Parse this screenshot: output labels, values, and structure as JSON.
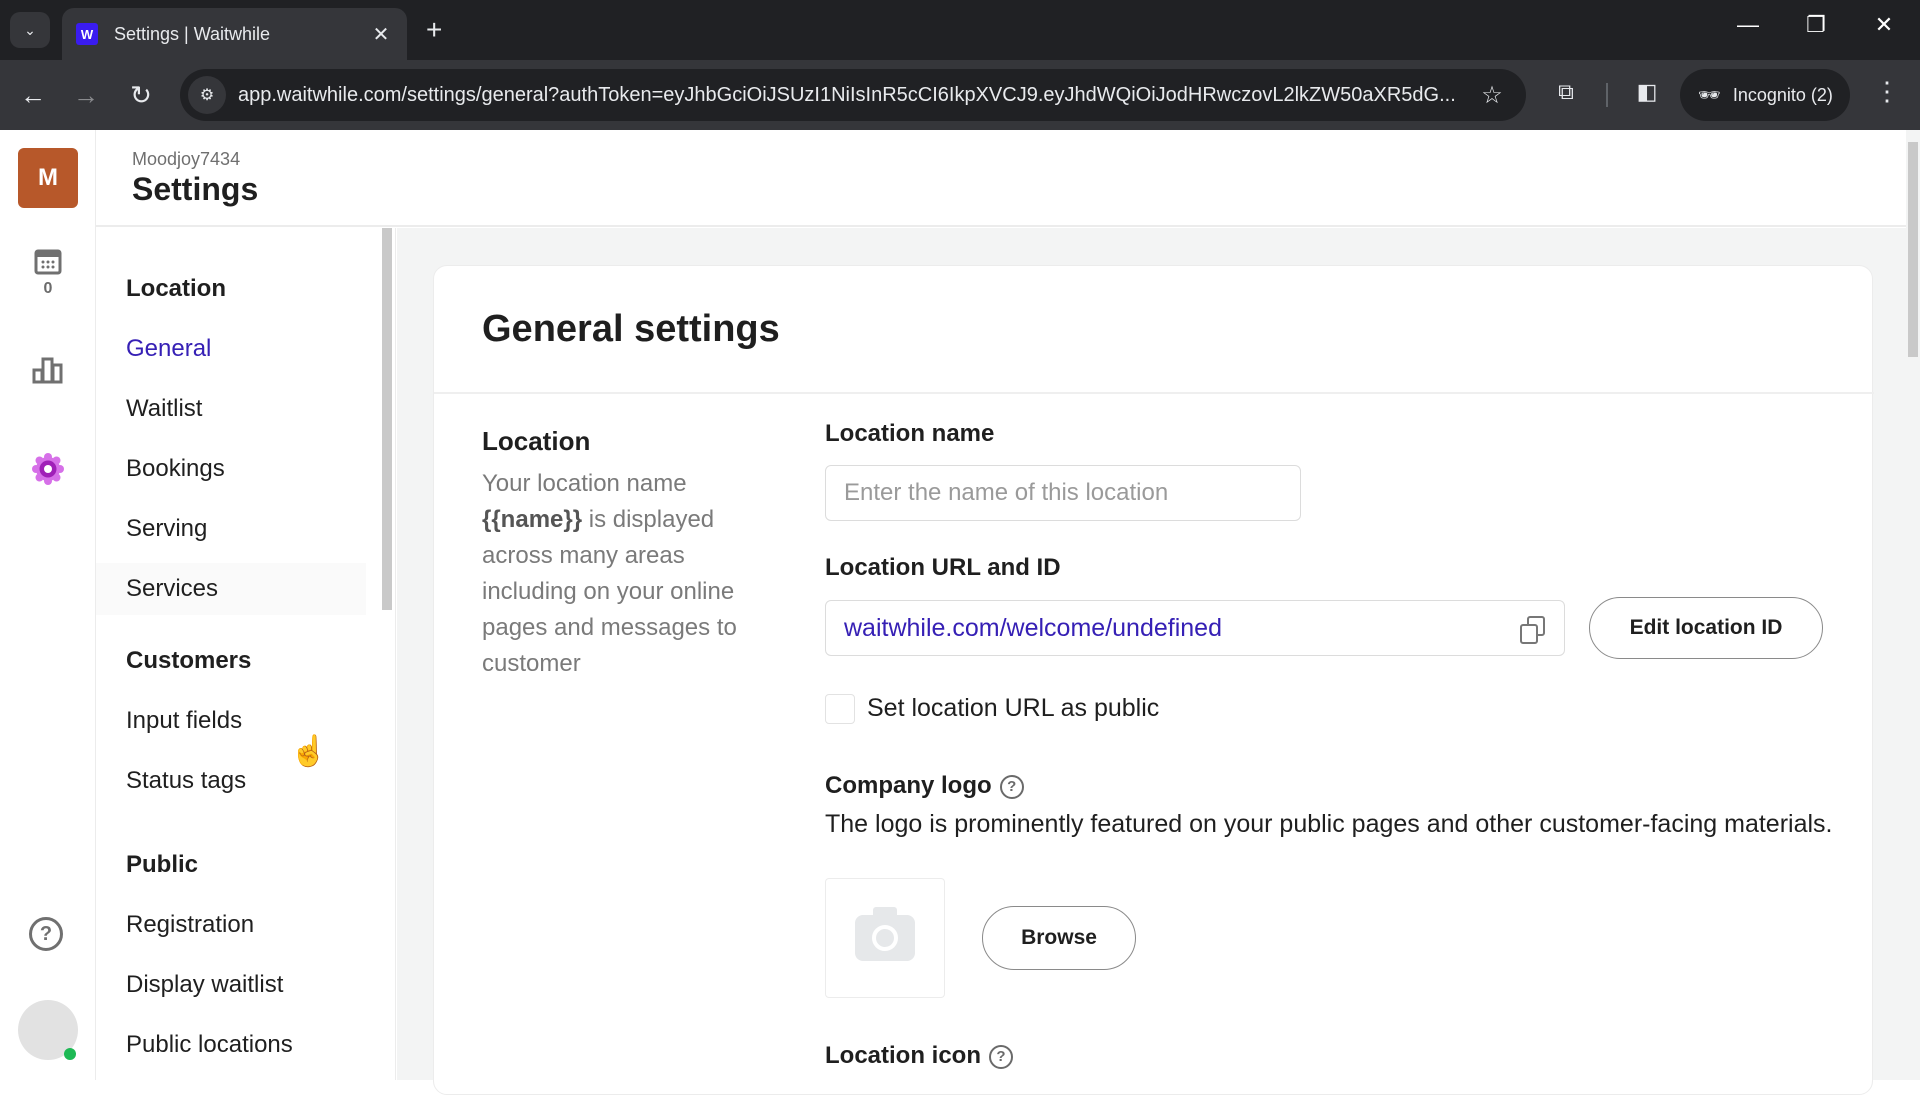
{
  "browser": {
    "tab_title": "Settings | Waitwhile",
    "favicon_letter": "W",
    "new_tab_glyph": "+",
    "tab_close_glyph": "✕",
    "url": "app.waitwhile.com/settings/general?authToken=eyJhbGciOiJSUzI1NiIsInR5cCI6IkpXVCJ9.eyJhdWQiOiJodHRwczovL2lkZW50aXR5dG...",
    "incognito_label": "Incognito (2)",
    "icons": {
      "tab_search": "chevron-down-icon",
      "back": "back-arrow-icon",
      "forward": "forward-arrow-icon",
      "reload": "reload-icon",
      "site_info": "site-info-icon",
      "bookmark": "star-icon",
      "extensions": "puzzle-icon",
      "side_panel": "side-panel-icon",
      "incognito": "incognito-icon",
      "menu": "kebab-menu-icon",
      "minimize": "minimize-icon",
      "restore": "restore-icon",
      "close": "close-icon"
    }
  },
  "rail": {
    "org_initial": "M",
    "org_color": "#b7582a",
    "calendar_count": "0",
    "help_glyph": "?",
    "presence_color": "#1db954"
  },
  "header": {
    "org_name": "Moodjoy7434",
    "title": "Settings"
  },
  "sidenav": {
    "sections": [
      {
        "title": "Location",
        "items": [
          {
            "label": "General",
            "active": true
          },
          {
            "label": "Waitlist"
          },
          {
            "label": "Bookings"
          },
          {
            "label": "Serving"
          },
          {
            "label": "Services"
          }
        ]
      },
      {
        "title": "Customers",
        "items": [
          {
            "label": "Input fields"
          },
          {
            "label": "Status tags"
          }
        ]
      },
      {
        "title": "Public",
        "items": [
          {
            "label": "Registration"
          },
          {
            "label": "Display waitlist"
          },
          {
            "label": "Public locations"
          }
        ]
      }
    ]
  },
  "main": {
    "title": "General settings",
    "location_section": {
      "title": "Location",
      "desc_before": "Your location name",
      "desc_token": "{{name}}",
      "desc_after": "is displayed across many areas including on your online pages and messages to customer"
    },
    "location_name": {
      "label": "Location name",
      "value": "",
      "placeholder": "Enter the name of this location"
    },
    "location_url": {
      "label": "Location URL and ID",
      "value": "waitwhile.com/welcome/undefined",
      "edit_button": "Edit location ID"
    },
    "public_url_checkbox": {
      "label": "Set location URL as public",
      "checked": false
    },
    "company_logo": {
      "label": "Company logo",
      "description": "The logo is prominently featured on your public pages and other customer-facing materials.",
      "browse_button": "Browse"
    },
    "location_icon": {
      "label": "Location icon"
    }
  },
  "colors": {
    "accent": "#3620b5",
    "page_bg": "#f3f4f4"
  }
}
